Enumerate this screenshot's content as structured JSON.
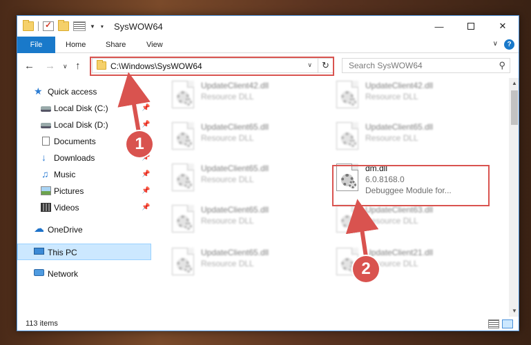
{
  "window": {
    "title": "SysWOW64"
  },
  "ribbon": {
    "tabs": [
      "File",
      "Home",
      "Share",
      "View"
    ]
  },
  "nav": {
    "address": "C:\\Windows\\SysWOW64",
    "search_placeholder": "Search SysWOW64"
  },
  "sidebar": {
    "items": [
      {
        "label": "Quick access"
      },
      {
        "label": "Local Disk (C:)"
      },
      {
        "label": "Local Disk (D:)"
      },
      {
        "label": "Documents"
      },
      {
        "label": "Downloads"
      },
      {
        "label": "Music"
      },
      {
        "label": "Pictures"
      },
      {
        "label": "Videos"
      },
      {
        "label": "OneDrive"
      },
      {
        "label": "This PC"
      },
      {
        "label": "Network"
      }
    ],
    "selected": "This PC"
  },
  "files": {
    "highlighted": {
      "name": "dm.dll",
      "version": "6.0.8168.0",
      "description": "Debuggee Module for..."
    },
    "blurred": [
      {
        "name": "UpdateClient42.dll",
        "type": "Resource DLL"
      },
      {
        "name": "UpdateClient42.dll",
        "type": "Resource DLL"
      },
      {
        "name": "UpdateClient65.dll",
        "type": "Resource DLL"
      },
      {
        "name": "UpdateClient65.dll",
        "type": "Resource DLL"
      },
      {
        "name": "UpdateClient65.dll",
        "type": "Resource DLL"
      },
      {
        "name": "UpdateClient65.dll",
        "type": "Resource DLL"
      },
      {
        "name": "UpdateClient63.dll",
        "type": "Resource DLL"
      },
      {
        "name": "UpdateClient65.dll",
        "type": "Resource DLL"
      },
      {
        "name": "UpdateClient21.dll",
        "type": "Resource DLL"
      }
    ]
  },
  "status": {
    "item_count": "113 items"
  },
  "annotations": {
    "marker1": "1",
    "marker2": "2"
  },
  "colors": {
    "accent": "#1979ca",
    "highlight": "#d9534f",
    "selected_bg": "#cce8ff"
  }
}
